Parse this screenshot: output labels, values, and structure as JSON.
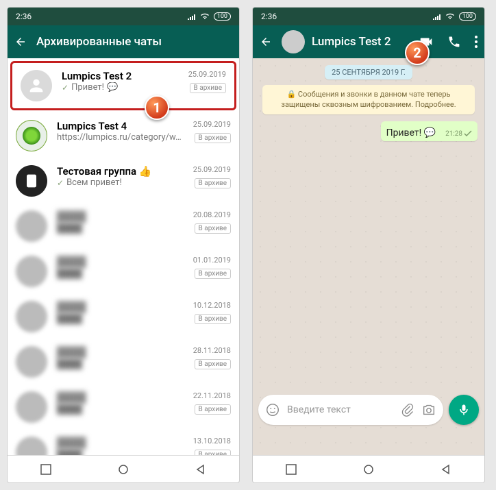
{
  "status": {
    "time": "2:36",
    "battery": "100"
  },
  "left": {
    "title": "Архивированные чаты",
    "archive_label": "В архиве",
    "items": [
      {
        "name": "Lumpics Test 2",
        "preview": "Привет!",
        "date": "25.09.2019",
        "tick": true,
        "blurred": false,
        "avatar": "default"
      },
      {
        "name": "Lumpics Test 4",
        "preview": "https://lumpics.ru/category/w…",
        "date": "25.09.2019",
        "tick": false,
        "blurred": false,
        "avatar": "green"
      },
      {
        "name": "Тестовая группа 👍",
        "preview": "Всем привет!",
        "date": "25.09.2019",
        "tick": true,
        "blurred": false,
        "avatar": "dark"
      },
      {
        "name": "████",
        "preview": "████",
        "date": "20.08.2019",
        "blurred": true
      },
      {
        "name": "████",
        "preview": "████",
        "date": "01.01.2019",
        "blurred": true
      },
      {
        "name": "████",
        "preview": "████",
        "date": "10.12.2018",
        "blurred": true
      },
      {
        "name": "████",
        "preview": "████",
        "date": "28.11.2018",
        "blurred": true
      },
      {
        "name": "████",
        "preview": "████",
        "date": "22.11.2018",
        "blurred": true
      },
      {
        "name": "████",
        "preview": "████",
        "date": "13.10.2018",
        "blurred": true
      }
    ]
  },
  "right": {
    "title": "Lumpics Test 2",
    "date_chip": "25 СЕНТЯБРЯ 2019 Г.",
    "encryption": "🔒 Сообщения и звонки в данном чате теперь защищены сквозным шифрованием. Подробнее.",
    "message": {
      "text": "Привет! 💬",
      "time": "21:28"
    },
    "input_placeholder": "Введите текст"
  },
  "callouts": {
    "one": "1",
    "two": "2"
  }
}
